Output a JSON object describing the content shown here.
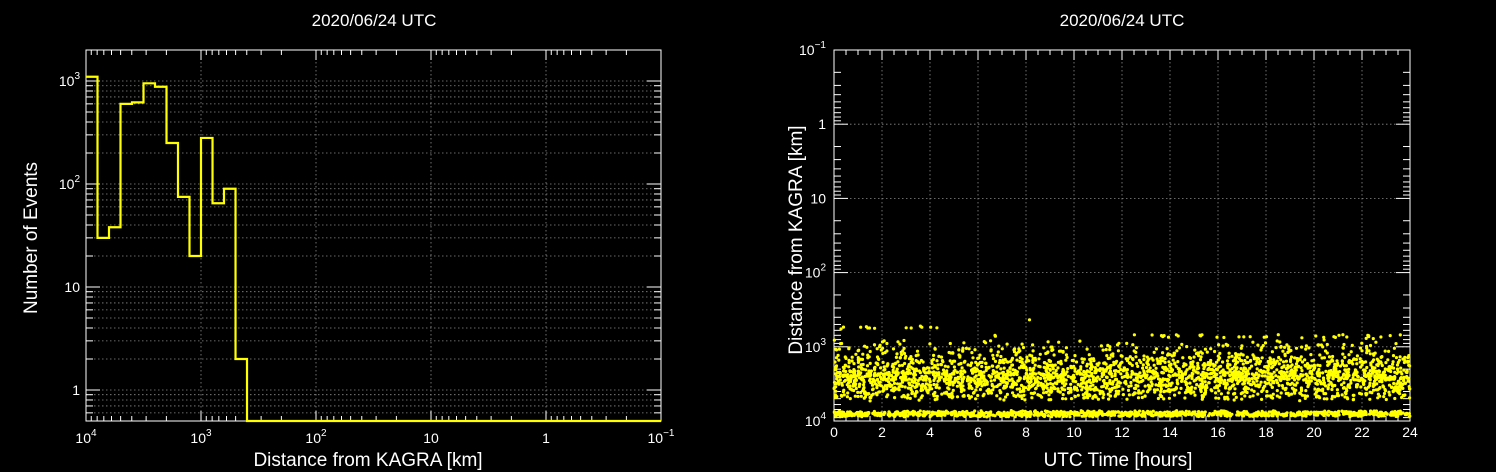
{
  "chart_data": [
    {
      "type": "bar",
      "title": "2020/06/24 UTC",
      "xlabel": "Distance from KAGRA [km]",
      "ylabel": "Number of Events",
      "x_scale": "log",
      "x_reversed": true,
      "xlim": [
        10000,
        0.1
      ],
      "y_scale": "log",
      "ylim": [
        0.5,
        2000
      ],
      "grid": true,
      "x_ticks": [
        {
          "base": "10",
          "exp": "4"
        },
        {
          "base": "10",
          "exp": "3"
        },
        {
          "base": "10",
          "exp": "2"
        },
        {
          "base": "10",
          "exp": ""
        },
        {
          "base": "1",
          "exp": ""
        },
        {
          "base": "10",
          "exp": "−1"
        }
      ],
      "y_ticks": [
        {
          "base": "10",
          "exp": "3"
        },
        {
          "base": "10",
          "exp": "2"
        },
        {
          "base": "10",
          "exp": ""
        },
        {
          "base": "1",
          "exp": ""
        }
      ],
      "bin_edges": [
        10000,
        7943,
        6310,
        5012,
        3981,
        3162,
        2512,
        1995,
        1585,
        1259,
        1000,
        794,
        631,
        501,
        398
      ],
      "values": [
        1100,
        30,
        38,
        600,
        620,
        950,
        880,
        250,
        75,
        20,
        280,
        65,
        90,
        2
      ],
      "color": "#ffff00"
    },
    {
      "type": "scatter",
      "title": "2020/06/24 UTC",
      "xlabel": "UTC Time [hours]",
      "ylabel": "Distance from KAGRA [km]",
      "xlim": [
        0,
        24
      ],
      "y_scale": "log",
      "y_reversed": true,
      "ylim": [
        0.1,
        10000
      ],
      "grid": true,
      "x_ticks": [
        "0",
        "2",
        "4",
        "6",
        "8",
        "10",
        "12",
        "14",
        "16",
        "18",
        "20",
        "22",
        "24"
      ],
      "y_ticks": [
        {
          "base": "10",
          "exp": "−1"
        },
        {
          "base": "1",
          "exp": ""
        },
        {
          "base": "10",
          "exp": ""
        },
        {
          "base": "10",
          "exp": "2"
        },
        {
          "base": "10",
          "exp": "3"
        },
        {
          "base": "10",
          "exp": "4"
        }
      ],
      "bands": [
        {
          "distance": 550,
          "time_ranges": [
            [
              0,
              1.7
            ],
            [
              2.7,
              3.8
            ],
            [
              3.9,
              4.3
            ]
          ],
          "density": 4,
          "spread": 0.02
        },
        {
          "distance": 420,
          "time_ranges": [
            [
              8.1,
              8.3
            ]
          ],
          "density": 6,
          "spread": 0.05
        },
        {
          "distance": 720,
          "time_ranges": [
            [
              6.3,
              6.8
            ],
            [
              12.5,
              15.5
            ],
            [
              15.2,
              24
            ]
          ],
          "density": 3,
          "spread": 0.03
        },
        {
          "distance": 1200,
          "time_ranges": [
            [
              0,
              24
            ]
          ],
          "density": 14,
          "spread": 0.12
        },
        {
          "distance": 2000,
          "time_ranges": [
            [
              0,
              24
            ]
          ],
          "density": 40,
          "spread": 0.12
        },
        {
          "distance": 2800,
          "time_ranges": [
            [
              0,
              24
            ]
          ],
          "density": 40,
          "spread": 0.1
        },
        {
          "distance": 4100,
          "time_ranges": [
            [
              0,
              24
            ]
          ],
          "density": 22,
          "spread": 0.08
        },
        {
          "distance": 8000,
          "time_ranges": [
            [
              0,
              24
            ]
          ],
          "density": 45,
          "spread": 0.03
        }
      ],
      "color": "#ffff00"
    }
  ]
}
